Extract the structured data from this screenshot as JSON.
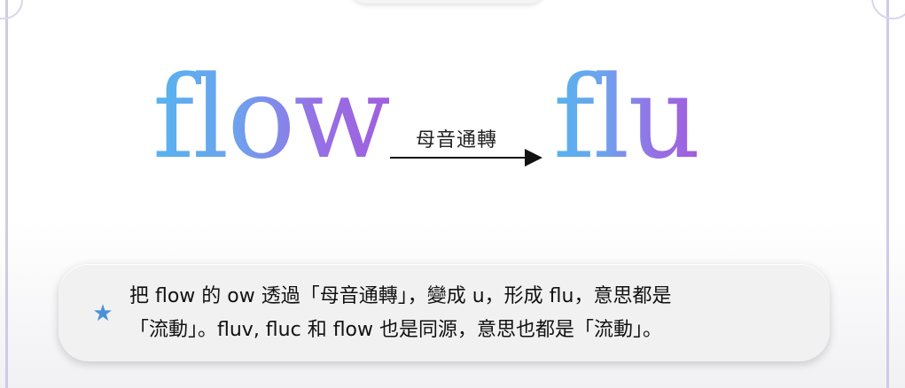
{
  "diagram": {
    "source_word": "flow",
    "target_word": "flu",
    "arrow_label": "母音通轉"
  },
  "note": {
    "icon": "star-icon",
    "line1": "把 flow 的 ow 透過「母音通轉」，變成 u，形成 flu，意思都是",
    "line2": "「流動」。fluv, fluc 和 flow 也是同源，意思也都是「流動」。"
  },
  "colors": {
    "gradient_start": "#56b3ef",
    "gradient_end": "#a05fdd",
    "star": "#4a90d9",
    "frame": "#cfcbe6"
  }
}
